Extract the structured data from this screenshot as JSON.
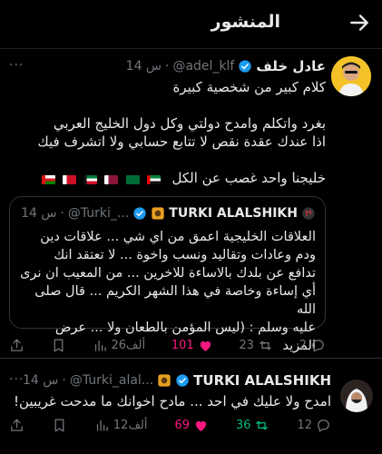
{
  "header": {
    "title": "المنشور"
  },
  "post": {
    "author_name": "عادل خلف",
    "handle": "@adel_klf",
    "time": "14 س",
    "lines": [
      "كلام كبير من شخصية كبيرة",
      "",
      "بغرد واتكلم وامدح دولتي وكل دول الخليج العربي",
      "اذا عندك عقدة نقص لا تتابع حسابي ولا اتشرف فيك",
      "",
      "خليجنا واحد غصب عن الكل"
    ],
    "flags": [
      "oman",
      "bahrain",
      "kuwait",
      "qatar",
      "saudi",
      "uae"
    ],
    "quote": {
      "name": "TURKI ALALSHIKH",
      "handle": "@Turki_...",
      "time": "14 س",
      "text_lines": [
        "العلاقات الخليجية اعمق من اي شي ... علاقات دين",
        "ودم وعادات وتقاليد ونسب واخوة ... لا تعتقد انك",
        "تدافع عن بلدك بالاساءة للاخرين ... من المعيب ان نرى",
        "أي إساءة وخاصة في هذا الشهر الكريم ... قال صلى الله",
        "عليه وسلم : (ليس المؤمن بالطعان ولا ... عرض المزيد"
      ]
    },
    "actions": {
      "replies": "2",
      "reposts": "23",
      "likes": "101",
      "views": "26ألف"
    }
  },
  "reply": {
    "name": "TURKI ALALSHIKH",
    "handle": "@Turki_alal...",
    "time": "14 س",
    "text": "امدح ولا عليك في احد ... مادح اخوانك ما مدحت غريبين!",
    "actions": {
      "replies": "12",
      "reposts": "36",
      "likes": "69",
      "views": "12ألف"
    }
  },
  "colors": {
    "accent": "#1d9bf0",
    "like": "#f91880",
    "repost": "#00ba7c",
    "muted": "#71767b"
  }
}
